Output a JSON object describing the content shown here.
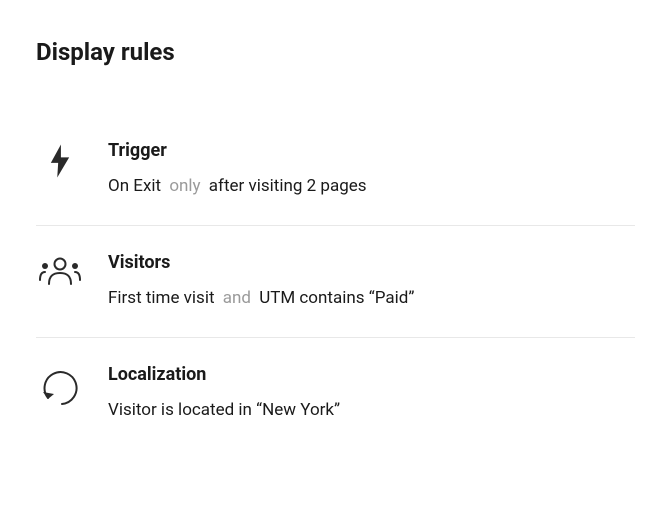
{
  "title": "Display rules",
  "rules": {
    "trigger": {
      "title": "Trigger",
      "part1": "On Exit",
      "connector": "only",
      "part2": "after visiting 2 pages"
    },
    "visitors": {
      "title": "Visitors",
      "part1": "First time visit",
      "connector": "and",
      "part2": "UTM contains “Paid”"
    },
    "localization": {
      "title": "Localization",
      "part1": "Visitor is located in “New York”"
    }
  }
}
